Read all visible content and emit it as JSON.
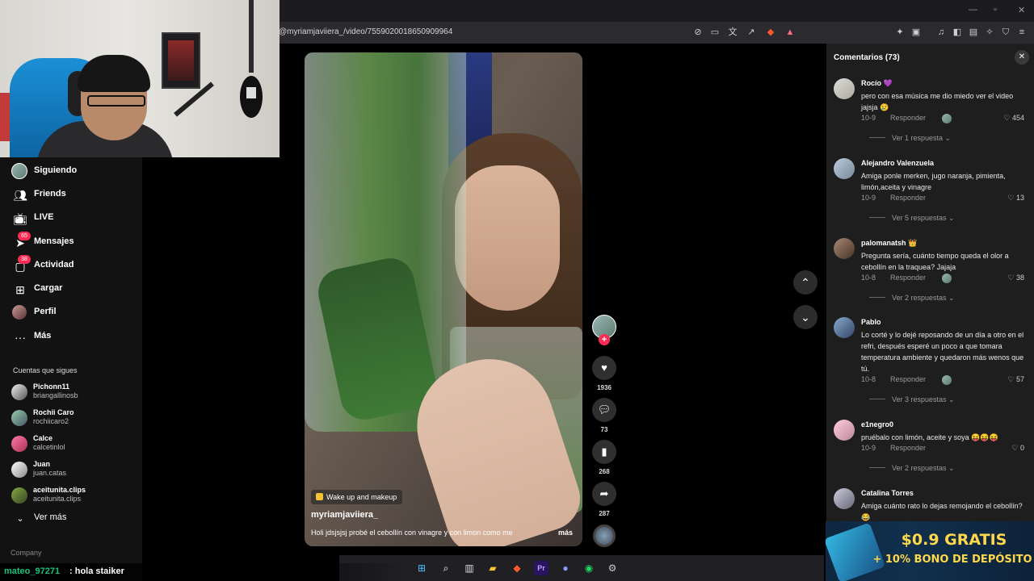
{
  "browser": {
    "url": "@myriamjaviiera_/video/7559020018650909964"
  },
  "sidebar": {
    "nav": [
      {
        "label": "Siguiendo",
        "icon": "following-avatar-icon"
      },
      {
        "label": "Friends",
        "icon": "friends-icon"
      },
      {
        "label": "LIVE",
        "icon": "live-icon"
      },
      {
        "label": "Mensajes",
        "icon": "messages-icon",
        "badge": "65"
      },
      {
        "label": "Actividad",
        "icon": "activity-icon",
        "badge": "38"
      },
      {
        "label": "Cargar",
        "icon": "upload-icon"
      },
      {
        "label": "Perfil",
        "icon": "profile-icon"
      },
      {
        "label": "Más",
        "icon": "more-icon"
      }
    ],
    "following_title": "Cuentas que sigues",
    "following": [
      {
        "name": "Pichonn11",
        "user": "briangallinosb"
      },
      {
        "name": "Rochii Caro",
        "user": "rochiicaro2"
      },
      {
        "name": "Calce",
        "user": "calcetinlol"
      },
      {
        "name": "Juan",
        "user": "juan.catas"
      },
      {
        "name": "aceitunita.clips",
        "user": "aceitunita.clips"
      }
    ],
    "see_more": "Ver más",
    "company": "Company"
  },
  "chat": {
    "user": "mateo_97271",
    "message": ": hola staiker"
  },
  "video": {
    "tag": "Wake up and makeup",
    "author": "myriamjaviiera_",
    "caption": "Holi jdsjsjsj probé el cebollín con vinagre y con limon como me",
    "more": "más"
  },
  "actions": {
    "likes": "1936",
    "comments": "73",
    "saves": "268",
    "shares": "287"
  },
  "comments_panel": {
    "title": "Comentarios (73)",
    "reply_label": "Responder",
    "items": [
      {
        "name": "Rocío 💜",
        "text": "pero con esa música me dio miedo ver el video jajsja 😢",
        "date": "10-9",
        "likes": "454",
        "view": "Ver 1 respuesta"
      },
      {
        "name": "Alejandro Valenzuela",
        "text": "Amiga ponle merken, jugo naranja, pimienta, limón,aceita y vinagre",
        "date": "10-9",
        "likes": "13",
        "view": "Ver 5 respuestas"
      },
      {
        "name": "palomanatsh 👑",
        "text": "Pregunta sería, cuánto tiempo queda el olor a cebollín en la traquea? Jajaja",
        "date": "10-8",
        "likes": "38",
        "view": "Ver 2 respuestas"
      },
      {
        "name": "Pablo",
        "text": "Lo corté y lo dejé reposando de un día a otro en el refri, después esperé un poco a que tomara temperatura ambiente y quedaron más wenos que tú.",
        "date": "10-8",
        "likes": "57",
        "view": "Ver 3 respuestas"
      },
      {
        "name": "e1negro0",
        "text": "pruébalo con limón, aceite y soya 😝😝😝",
        "date": "10-9",
        "likes": "0",
        "view": "Ver 2 respuestas"
      },
      {
        "name": "Catalina Torres",
        "text": "Amiga cuánto rato lo dejas remojando el cebollín? 😂",
        "date": "",
        "likes": "",
        "view": ""
      }
    ]
  },
  "ad": {
    "line1": "$0.9 GRATIS",
    "line2": "+ 10% BONO DE DEPÓSITO"
  }
}
